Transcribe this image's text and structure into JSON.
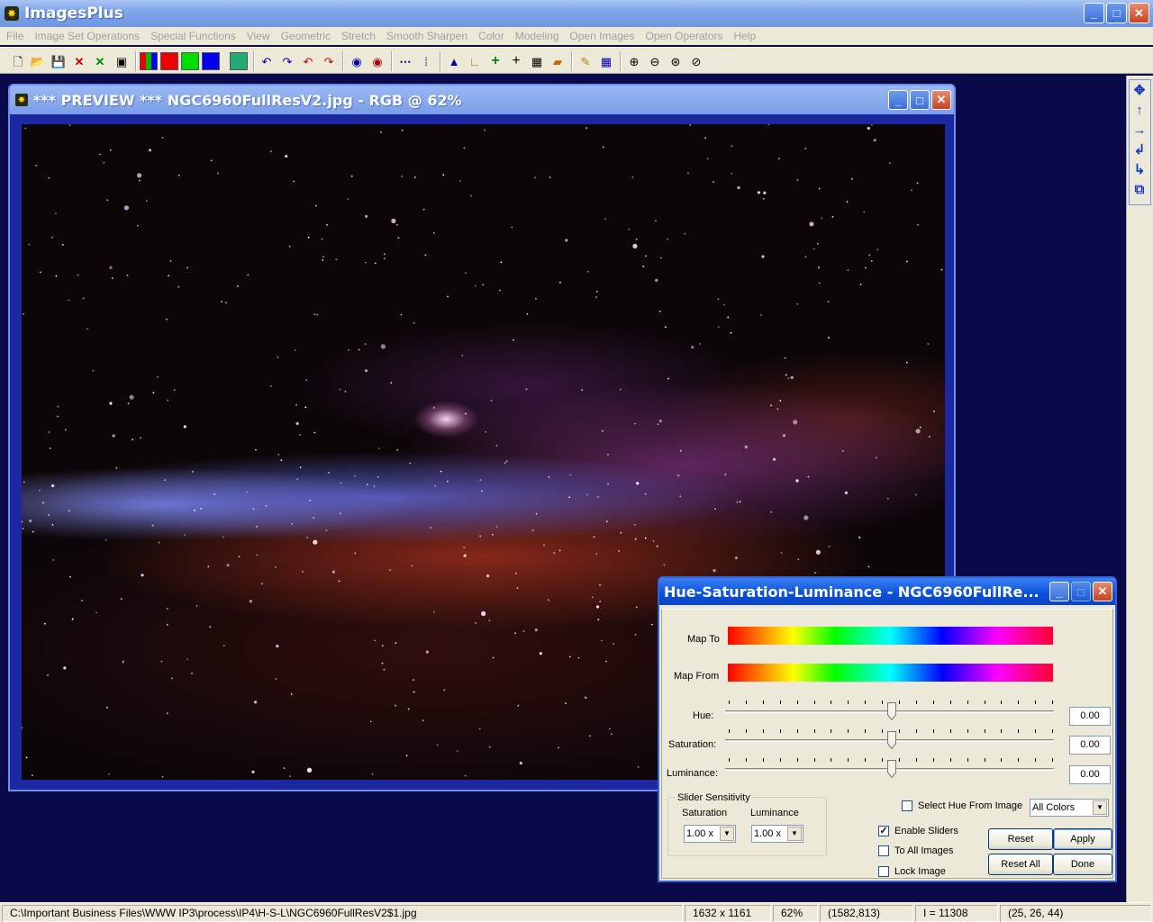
{
  "app": {
    "title": "ImagesPlus",
    "minimize": "_",
    "maximize": "□",
    "close": "✕"
  },
  "menu": [
    "File",
    "Image Set Operations",
    "Special Functions",
    "View",
    "Geometric",
    "Stretch",
    "Smooth Sharpen",
    "Color",
    "Modeling",
    "Open Images",
    "Open Operators",
    "Help"
  ],
  "toolbar_icons": [
    "new-file-icon",
    "open-folder-icon",
    "save-icon",
    "close-red-x-icon",
    "close-green-x-icon",
    "print-icon",
    "rgb-channels-icon",
    "red-channel-icon",
    "green-channel-icon",
    "blue-channel-icon",
    "select-icon",
    "undo-icon",
    "redo-icon",
    "undo-red-icon",
    "redo-red-icon",
    "circle-select-icon",
    "circle-red-icon",
    "dots-icon",
    "graph-icon",
    "histogram-icon",
    "axis-icon",
    "crosshair-green-icon",
    "crosshair-icon",
    "grid-icon",
    "colorize-icon",
    "pencil-icon",
    "table-icon",
    "zoom-in-icon",
    "zoom-out-icon",
    "zoom-fit-icon",
    "zoom-reset-icon"
  ],
  "right_toolbar_icons": [
    "move-all-icon",
    "arrow-up-icon",
    "arrow-right-icon",
    "rotate-left-icon",
    "rotate-right-icon",
    "copy-icon"
  ],
  "preview": {
    "title": "*** PREVIEW *** NGC6960FullResV2.jpg - RGB @ 62%"
  },
  "hsl": {
    "title": "Hue-Saturation-Luminance - NGC6960FullRe...",
    "map_to_label": "Map To",
    "map_from_label": "Map From",
    "hue_label": "Hue:",
    "saturation_label": "Saturation:",
    "luminance_label": "Luminance:",
    "hue_value": "0.00",
    "saturation_value": "0.00",
    "luminance_value": "0.00",
    "select_hue_label": "Select Hue From Image",
    "select_hue_checked": false,
    "color_combo": "All Colors",
    "slider_sensitivity_label": "Slider Sensitivity",
    "sat_sens_label": "Saturation",
    "lum_sens_label": "Luminance",
    "sat_sens_value": "1.00 x",
    "lum_sens_value": "1.00 x",
    "enable_sliders_label": "Enable Sliders",
    "enable_sliders_checked": true,
    "to_all_images_label": "To All Images",
    "to_all_images_checked": false,
    "lock_image_label": "Lock Image",
    "lock_image_checked": false,
    "reset_label": "Reset",
    "apply_label": "Apply",
    "reset_all_label": "Reset All",
    "done_label": "Done"
  },
  "status": {
    "path": "C:\\Important Business Files\\WWW IP3\\process\\IP4\\H-S-L\\NGC6960FullResV2$1.jpg",
    "dimensions": "1632 x 1161",
    "zoom": "62%",
    "coords": "(1582,813)",
    "intensity": "I = 11308",
    "rgb": "(25, 26, 44)"
  }
}
